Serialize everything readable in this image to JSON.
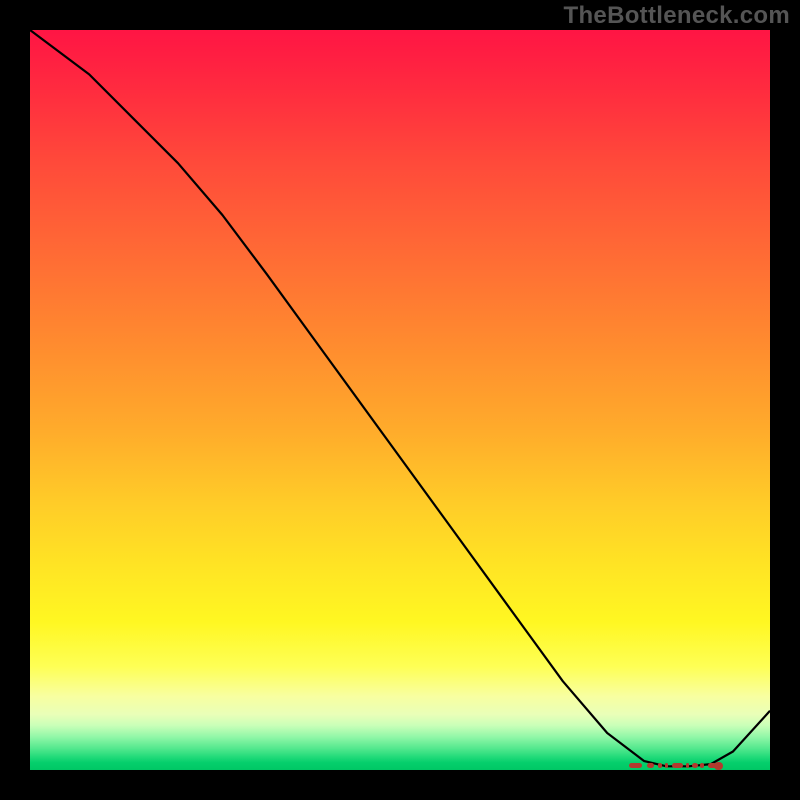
{
  "watermark": "TheBottleneck.com",
  "chart_data": {
    "type": "line",
    "title": "",
    "xlabel": "",
    "ylabel": "",
    "xlim": [
      0,
      100
    ],
    "ylim": [
      0,
      100
    ],
    "x": [
      0,
      8,
      14,
      20,
      26,
      32,
      40,
      48,
      56,
      64,
      72,
      78,
      83,
      86,
      89,
      92,
      95,
      100
    ],
    "values": [
      100,
      94,
      88,
      82,
      75,
      67,
      56,
      45,
      34,
      23,
      12,
      5,
      1.2,
      0.5,
      0.5,
      0.8,
      2.5,
      8
    ],
    "annotations": [
      {
        "kind": "flat-region-marker",
        "x_start": 81,
        "x_end": 93,
        "y": 0.6
      }
    ],
    "background": "vertical-gradient red→orange→yellow→green",
    "colors": {
      "curve": "#000000",
      "marker": "#b33a2e"
    }
  }
}
